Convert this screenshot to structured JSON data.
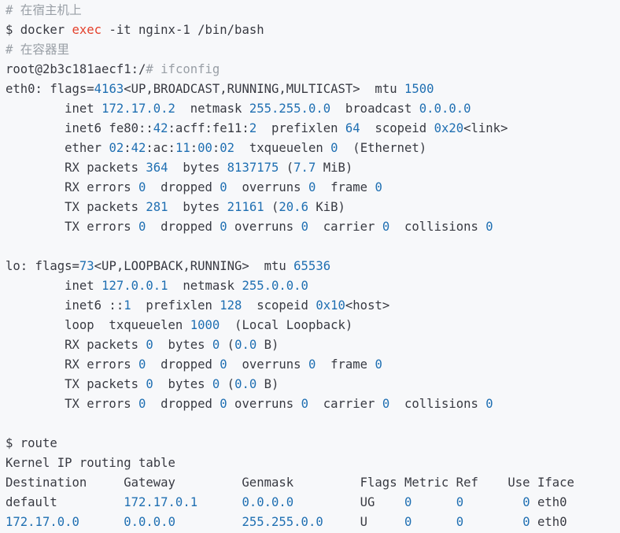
{
  "lines": [
    [
      {
        "t": "# 在宿主机上",
        "s": "c"
      }
    ],
    [
      {
        "t": "$ docker "
      },
      {
        "t": "exec",
        "s": "k"
      },
      {
        "t": " -it nginx-1 /bin/bash"
      }
    ],
    [
      {
        "t": "# 在容器里",
        "s": "c"
      }
    ],
    [
      {
        "t": "root@2b3c181aecf1:/",
        "s": ""
      },
      {
        "t": "# ifconfig",
        "s": "c"
      }
    ],
    [
      {
        "t": "eth0: flags="
      },
      {
        "t": "4163",
        "s": "n"
      },
      {
        "t": "<UP,BROADCAST,RUNNING,MULTICAST>  mtu "
      },
      {
        "t": "1500",
        "s": "n"
      }
    ],
    [
      {
        "t": "        inet "
      },
      {
        "t": "172.17.0.2",
        "s": "n"
      },
      {
        "t": "  netmask "
      },
      {
        "t": "255.255.0.0",
        "s": "n"
      },
      {
        "t": "  broadcast "
      },
      {
        "t": "0.0.0.0",
        "s": "n"
      }
    ],
    [
      {
        "t": "        inet6 fe80::"
      },
      {
        "t": "42",
        "s": "n"
      },
      {
        "t": ":acff:fe11:"
      },
      {
        "t": "2",
        "s": "n"
      },
      {
        "t": "  prefixlen "
      },
      {
        "t": "64",
        "s": "n"
      },
      {
        "t": "  scopeid "
      },
      {
        "t": "0x20",
        "s": "n"
      },
      {
        "t": "<link>"
      }
    ],
    [
      {
        "t": "        ether "
      },
      {
        "t": "02",
        "s": "n"
      },
      {
        "t": ":"
      },
      {
        "t": "42",
        "s": "n"
      },
      {
        "t": ":ac:"
      },
      {
        "t": "11",
        "s": "n"
      },
      {
        "t": ":"
      },
      {
        "t": "00",
        "s": "n"
      },
      {
        "t": ":"
      },
      {
        "t": "02",
        "s": "n"
      },
      {
        "t": "  txqueuelen "
      },
      {
        "t": "0",
        "s": "n"
      },
      {
        "t": "  (Ethernet)"
      }
    ],
    [
      {
        "t": "        RX packets "
      },
      {
        "t": "364",
        "s": "n"
      },
      {
        "t": "  bytes "
      },
      {
        "t": "8137175",
        "s": "n"
      },
      {
        "t": " ("
      },
      {
        "t": "7.7",
        "s": "n"
      },
      {
        "t": " MiB)"
      }
    ],
    [
      {
        "t": "        RX errors "
      },
      {
        "t": "0",
        "s": "n"
      },
      {
        "t": "  dropped "
      },
      {
        "t": "0",
        "s": "n"
      },
      {
        "t": "  overruns "
      },
      {
        "t": "0",
        "s": "n"
      },
      {
        "t": "  frame "
      },
      {
        "t": "0",
        "s": "n"
      }
    ],
    [
      {
        "t": "        TX packets "
      },
      {
        "t": "281",
        "s": "n"
      },
      {
        "t": "  bytes "
      },
      {
        "t": "21161",
        "s": "n"
      },
      {
        "t": " ("
      },
      {
        "t": "20.6",
        "s": "n"
      },
      {
        "t": " KiB)"
      }
    ],
    [
      {
        "t": "        TX errors "
      },
      {
        "t": "0",
        "s": "n"
      },
      {
        "t": "  dropped "
      },
      {
        "t": "0",
        "s": "n"
      },
      {
        "t": " overruns "
      },
      {
        "t": "0",
        "s": "n"
      },
      {
        "t": "  carrier "
      },
      {
        "t": "0",
        "s": "n"
      },
      {
        "t": "  collisions "
      },
      {
        "t": "0",
        "s": "n"
      }
    ],
    [],
    [
      {
        "t": "lo: flags="
      },
      {
        "t": "73",
        "s": "n"
      },
      {
        "t": "<UP,LOOPBACK,RUNNING>  mtu "
      },
      {
        "t": "65536",
        "s": "n"
      }
    ],
    [
      {
        "t": "        inet "
      },
      {
        "t": "127.0.0.1",
        "s": "n"
      },
      {
        "t": "  netmask "
      },
      {
        "t": "255.0.0.0",
        "s": "n"
      }
    ],
    [
      {
        "t": "        inet6 ::"
      },
      {
        "t": "1",
        "s": "n"
      },
      {
        "t": "  prefixlen "
      },
      {
        "t": "128",
        "s": "n"
      },
      {
        "t": "  scopeid "
      },
      {
        "t": "0x10",
        "s": "n"
      },
      {
        "t": "<host>"
      }
    ],
    [
      {
        "t": "        loop  txqueuelen "
      },
      {
        "t": "1000",
        "s": "n"
      },
      {
        "t": "  (Local Loopback)"
      }
    ],
    [
      {
        "t": "        RX packets "
      },
      {
        "t": "0",
        "s": "n"
      },
      {
        "t": "  bytes "
      },
      {
        "t": "0",
        "s": "n"
      },
      {
        "t": " ("
      },
      {
        "t": "0.0",
        "s": "n"
      },
      {
        "t": " B)"
      }
    ],
    [
      {
        "t": "        RX errors "
      },
      {
        "t": "0",
        "s": "n"
      },
      {
        "t": "  dropped "
      },
      {
        "t": "0",
        "s": "n"
      },
      {
        "t": "  overruns "
      },
      {
        "t": "0",
        "s": "n"
      },
      {
        "t": "  frame "
      },
      {
        "t": "0",
        "s": "n"
      }
    ],
    [
      {
        "t": "        TX packets "
      },
      {
        "t": "0",
        "s": "n"
      },
      {
        "t": "  bytes "
      },
      {
        "t": "0",
        "s": "n"
      },
      {
        "t": " ("
      },
      {
        "t": "0.0",
        "s": "n"
      },
      {
        "t": " B)"
      }
    ],
    [
      {
        "t": "        TX errors "
      },
      {
        "t": "0",
        "s": "n"
      },
      {
        "t": "  dropped "
      },
      {
        "t": "0",
        "s": "n"
      },
      {
        "t": " overruns "
      },
      {
        "t": "0",
        "s": "n"
      },
      {
        "t": "  carrier "
      },
      {
        "t": "0",
        "s": "n"
      },
      {
        "t": "  collisions "
      },
      {
        "t": "0",
        "s": "n"
      }
    ],
    [],
    [
      {
        "t": "$ route"
      }
    ],
    [
      {
        "t": "Kernel IP routing table"
      }
    ],
    [
      {
        "t": "Destination     Gateway         Genmask         Flags Metric Ref    Use Iface"
      }
    ],
    [
      {
        "t": "default         "
      },
      {
        "t": "172.17.0.1",
        "s": "n"
      },
      {
        "t": "      "
      },
      {
        "t": "0.0.0.0",
        "s": "n"
      },
      {
        "t": "         UG    "
      },
      {
        "t": "0",
        "s": "n"
      },
      {
        "t": "      "
      },
      {
        "t": "0",
        "s": "n"
      },
      {
        "t": "        "
      },
      {
        "t": "0",
        "s": "n"
      },
      {
        "t": " eth0"
      }
    ],
    [
      {
        "t": "172.17.0.0",
        "s": "n"
      },
      {
        "t": "      "
      },
      {
        "t": "0.0.0.0",
        "s": "n"
      },
      {
        "t": "         "
      },
      {
        "t": "255.255.0.0",
        "s": "n"
      },
      {
        "t": "     U     "
      },
      {
        "t": "0",
        "s": "n"
      },
      {
        "t": "      "
      },
      {
        "t": "0",
        "s": "n"
      },
      {
        "t": "        "
      },
      {
        "t": "0",
        "s": "n"
      },
      {
        "t": " eth0"
      }
    ]
  ]
}
